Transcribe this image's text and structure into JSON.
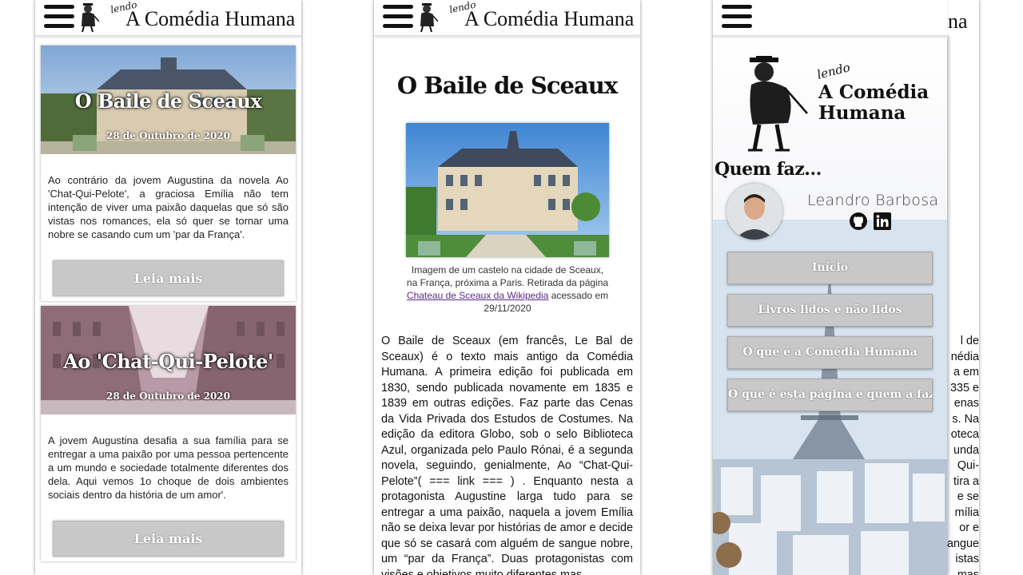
{
  "header": {
    "lendo": "lendo",
    "brand": "A Comédia Humana"
  },
  "feed": {
    "cards": [
      {
        "title": "O Baile de Sceaux",
        "date": "28 de Outubro de 2020",
        "excerpt": "Ao contrário da jovem Augustina da novela Ao 'Chat-Qui-Pelote', a graciosa Emília não tem intenção de viver uma paixão daquelas que só são vistas nos romances, ela só quer se tornar uma nobre se casando cum um 'par da França'.",
        "button": "Leia mais"
      },
      {
        "title": "Ao 'Chat-Qui-Pelote'",
        "date": "28 de Outubro de 2020",
        "excerpt": "A jovem Augustina desafia a sua família para se entregar a uma paixão por uma pessoa pertencente a um mundo e sociedade totalmente diferentes dos dela. Aqui vemos 1o choque de dois ambientes sociais dentro da história de um amor'.",
        "button": "Leia mais"
      }
    ]
  },
  "article": {
    "title": "O Baile de Sceaux",
    "caption_part1": "Imagem de um castelo na cidade de Sceaux, na França, próxima a Paris. Retirada da página ",
    "caption_link": "Chateau de Sceaux da Wikipedia",
    "caption_part2": " acessado em 29/11/2020",
    "body": "O Baile de Sceaux (em francês, Le Bal de Sceaux) é o texto mais antigo da Comédia Humana. A primeira edição foi publicada em 1830, sendo publicada novamente em 1835 e 1839 em outras edições. Faz parte das Cenas da Vida Privada dos Estudos de Costumes. Na edição da editora Globo, sob o selo Biblioteca Azul, organizada pelo Paulo Rónai, é a segunda novela, seguindo, genialmente, Ao “Chat-Qui-Pelote”( === link === ) . Enquanto nesta a protagonista Augustine larga tudo para se entregar a uma paixão, naquela a jovem Emília não se deixa levar por histórias de amor e decide que só se casará com alguém de sangue nobre, um “par da França”. Duas protagonistas com visões e objetivos muito diferentes mas"
  },
  "drawer": {
    "lendo": "lendo",
    "brand_line1": "A Comédia",
    "brand_line2": "Humana",
    "who_title": "Quem faz...",
    "author": "Leandro Barbosa",
    "peek_brand": "na",
    "peek_text": [
      "l de",
      "nédia",
      "a em",
      "335 e",
      "enas",
      "s. Na",
      "oteca",
      "unda",
      "Qui-",
      "tira a",
      "e se",
      "mília",
      "or e",
      "angue",
      "istas",
      "mas"
    ],
    "menu": [
      "Início",
      "Livros lidos e não lidos",
      "O que é a Comédia Humana",
      "O que é esta página e quem a faz"
    ]
  },
  "colors": {
    "button_gray": "#c8c8c8",
    "link_purple": "#5b2a86",
    "text": "#111111"
  },
  "icons": [
    "hamburger-menu-icon",
    "balzac-caricature-icon",
    "github-icon",
    "linkedin-icon"
  ]
}
